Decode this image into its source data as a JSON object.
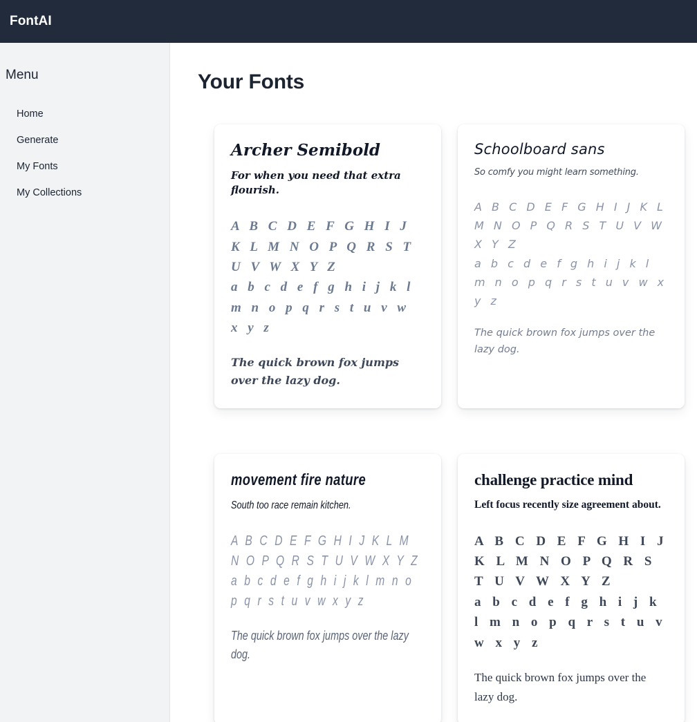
{
  "header": {
    "brand": "FontAI"
  },
  "sidebar": {
    "title": "Menu",
    "items": [
      {
        "label": "Home",
        "name": "sidebar-item-home"
      },
      {
        "label": "Generate",
        "name": "sidebar-item-generate"
      },
      {
        "label": "My Fonts",
        "name": "sidebar-item-my-fonts"
      },
      {
        "label": "My Collections",
        "name": "sidebar-item-my-collections"
      }
    ]
  },
  "main": {
    "page_title": "Your Fonts",
    "fonts": [
      {
        "name": "Archer Semibold",
        "tagline": "For when you need that extra flourish.",
        "alphabet_upper": "A B C D E F G H I J K L M N O P Q R S T U V W X Y Z",
        "alphabet_lower": "a b c d e f g h i j k l m n o p q r s t u v w x y z",
        "pangram": "The quick brown fox jumps over the lazy dog.",
        "style": "tf-serif-bold-italic"
      },
      {
        "name": "Schoolboard sans",
        "tagline": "So comfy you might learn something.",
        "alphabet_upper": "A B C D E F G H I J K L M N O P Q R S T U V W X Y Z",
        "alphabet_lower": "a b c d e f g h i j k l m n o p q r s t u v w x y z",
        "pangram": "The quick brown fox jumps over the lazy dog.",
        "style": "tf-sans-light-italic"
      },
      {
        "name": "movement fire nature",
        "tagline": "South too race remain kitchen.",
        "alphabet_upper": "A B C D E F G H I J K L M N O P Q R S T U V W X Y Z",
        "alphabet_lower": "a b c d e f g h i j k l m n o p q r s t u v w x y z",
        "pangram": "The quick brown fox jumps over the lazy dog.",
        "style": "tf-sans-condensed-oblique"
      },
      {
        "name": "challenge practice mind",
        "tagline": "Left focus recently size agreement about.",
        "alphabet_upper": "A B C D E F G H I J K L M N O P Q R S T U V W X Y Z",
        "alphabet_lower": "a b c d e f g h i j k l m n o p q r s t u v w x y z",
        "pangram": "The quick brown fox jumps over the lazy dog.",
        "style": "tf-serif-bold"
      }
    ]
  },
  "colors": {
    "topbar_bg": "#212b3b",
    "sidebar_bg": "#f1f3f5",
    "page_bg": "#ffffff",
    "text_dark": "#1c2431",
    "alphabet_muted": "#6b7a90"
  }
}
